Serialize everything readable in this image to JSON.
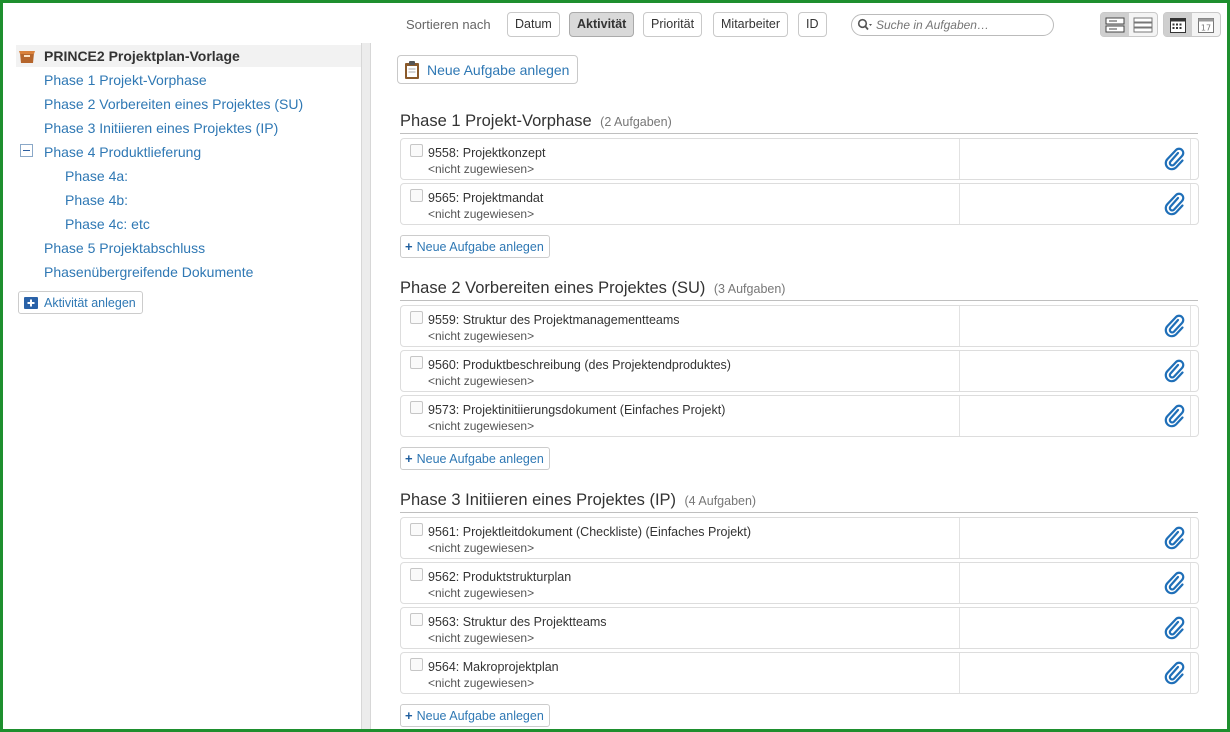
{
  "toolbar": {
    "sort_label": "Sortieren nach",
    "sort_options": [
      "Datum",
      "Aktivität",
      "Priorität",
      "Mitarbeiter",
      "ID"
    ],
    "active_sort": "Aktivität",
    "search_placeholder": "Suche in Aufgaben…"
  },
  "sidebar": {
    "root": "PRINCE2 Projektplan-Vorlage",
    "items": [
      "Phase 1 Projekt-Vorphase",
      "Phase 2 Vorbereiten eines Projektes (SU)",
      "Phase 3 Initiieren eines Projektes (IP)",
      "Phase 4 Produktlieferung",
      "Phase 4a:",
      "Phase 4b:",
      "Phase 4c: etc",
      "Phase 5 Projektabschluss",
      "Phasenübergreifende Dokumente"
    ],
    "add_activity": "Aktivität anlegen"
  },
  "main": {
    "new_task": "Neue Aufgabe anlegen",
    "add_task": "Neue Aufgabe anlegen",
    "phases": [
      {
        "title": "Phase 1 Projekt-Vorphase",
        "count": "(2 Aufgaben)",
        "tasks": [
          {
            "title": "9558: Projektkonzept",
            "assignee": "<nicht zugewiesen>"
          },
          {
            "title": "9565: Projektmandat",
            "assignee": "<nicht zugewiesen>"
          }
        ]
      },
      {
        "title": "Phase 2 Vorbereiten eines Projektes (SU)",
        "count": "(3 Aufgaben)",
        "tasks": [
          {
            "title": "9559: Struktur des Projektmanagementteams",
            "assignee": "<nicht zugewiesen>"
          },
          {
            "title": "9560: Produktbeschreibung (des Projektendproduktes)",
            "assignee": "<nicht zugewiesen>"
          },
          {
            "title": "9573: Projektinitiierungsdokument (Einfaches Projekt)",
            "assignee": "<nicht zugewiesen>"
          }
        ]
      },
      {
        "title": "Phase 3 Initiieren eines Projektes (IP)",
        "count": "(4 Aufgaben)",
        "tasks": [
          {
            "title": "9561: Projektleitdokument (Checkliste) (Einfaches Projekt)",
            "assignee": "<nicht zugewiesen>"
          },
          {
            "title": "9562: Produktstrukturplan",
            "assignee": "<nicht zugewiesen>"
          },
          {
            "title": "9563: Struktur des Projektteams",
            "assignee": "<nicht zugewiesen>"
          },
          {
            "title": "9564: Makroprojektplan",
            "assignee": "<nicht zugewiesen>"
          }
        ]
      }
    ]
  },
  "colors": {
    "link": "#2f78b4",
    "frame": "#1e8f2e",
    "attach": "#1f6fb8"
  }
}
